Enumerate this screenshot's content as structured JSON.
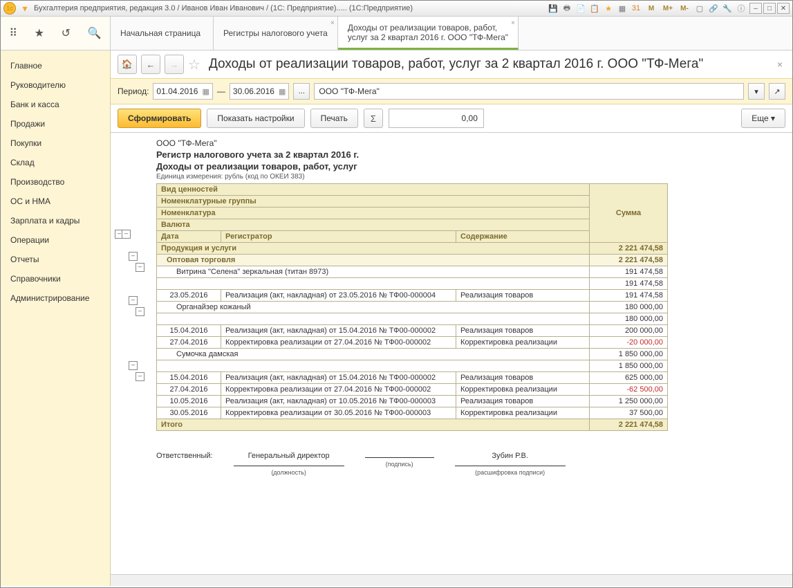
{
  "window_title": "Бухгалтерия предприятия, редакция 3.0 / Иванов Иван Иванович / (1С: Предприятие)..... (1С:Предприятие)",
  "tabs": [
    {
      "label": "Начальная страница"
    },
    {
      "label": "Регистры налогового учета"
    },
    {
      "label": "Доходы от реализации товаров, работ,",
      "label2": "услуг за 2 квартал 2016 г. ООО \"ТФ-Мега\""
    }
  ],
  "sidebar": [
    "Главное",
    "Руководителю",
    "Банк и касса",
    "Продажи",
    "Покупки",
    "Склад",
    "Производство",
    "ОС и НМА",
    "Зарплата и кадры",
    "Операции",
    "Отчеты",
    "Справочники",
    "Администрирование"
  ],
  "page_title": "Доходы от реализации товаров, работ, услуг за 2 квартал 2016 г. ООО \"ТФ-Мега\"",
  "period": {
    "label": "Период:",
    "from": "01.04.2016",
    "to": "30.06.2016",
    "dash": "—"
  },
  "org": "ООО \"ТФ-Мега\"",
  "buttons": {
    "run": "Сформировать",
    "settings": "Показать настройки",
    "print": "Печать",
    "more": "Еще"
  },
  "sumbox": "0,00",
  "report": {
    "org": "ООО \"ТФ-Мега\"",
    "title1": "Регистр налогового учета за 2 квартал 2016 г.",
    "title2": "Доходы от реализации товаров, работ, услуг",
    "unit": "Единица измерения:  рубль (код по ОКЕИ 383)",
    "headers": {
      "h1": "Вид ценностей",
      "h2": "Номенклатурные группы",
      "h3": "Номенклатура",
      "h4": "Валюта",
      "h5": "Дата",
      "h6": "Регистратор",
      "h7": "Содержание",
      "hsum": "Сумма"
    },
    "total_label": "Итого",
    "total": "2 221 474,58",
    "sign": {
      "resp": "Ответственный:",
      "post": "Генеральный директор",
      "post_cap": "(должность)",
      "sign_cap": "(подпись)",
      "name": "Зубин Р.В.",
      "name_cap": "(расшифровка подписи)"
    },
    "rows": [
      {
        "type": "grp",
        "c1": "Продукция и услуги",
        "sum": "2 221 474,58"
      },
      {
        "type": "sub",
        "c1": "Оптовая торговля",
        "sum": "2 221 474,58"
      },
      {
        "type": "nomh",
        "c1": "Витрина \"Селена\" зеркальная (титан 8973)",
        "sum": "191 474,58"
      },
      {
        "type": "cur",
        "c1": "",
        "sum": "191 474,58"
      },
      {
        "type": "row",
        "date": "23.05.2016",
        "reg": "Реализация (акт, накладная) от 23.05.2016 № ТФ00-000004",
        "cont": "Реализация товаров",
        "sum": "191 474,58"
      },
      {
        "type": "nomh",
        "c1": "Органайзер кожаный",
        "sum": "180 000,00"
      },
      {
        "type": "cur",
        "c1": "",
        "sum": "180 000,00"
      },
      {
        "type": "row",
        "date": "15.04.2016",
        "reg": "Реализация (акт, накладная) от 15.04.2016 № ТФ00-000002",
        "cont": "Реализация товаров",
        "sum": "200 000,00"
      },
      {
        "type": "row",
        "date": "27.04.2016",
        "reg": "Корректировка реализации от 27.04.2016 № ТФ00-000002",
        "cont": "Корректировка реализации",
        "sum": "-20 000,00",
        "neg": true
      },
      {
        "type": "nomh",
        "c1": "Сумочка дамская",
        "sum": "1 850 000,00"
      },
      {
        "type": "cur",
        "c1": "",
        "sum": "1 850 000,00"
      },
      {
        "type": "row",
        "date": "15.04.2016",
        "reg": "Реализация (акт, накладная) от 15.04.2016 № ТФ00-000002",
        "cont": "Реализация товаров",
        "sum": "625 000,00"
      },
      {
        "type": "row",
        "date": "27.04.2016",
        "reg": "Корректировка реализации от 27.04.2016 № ТФ00-000002",
        "cont": "Корректировка реализации",
        "sum": "-62 500,00",
        "neg": true
      },
      {
        "type": "row",
        "date": "10.05.2016",
        "reg": "Реализация (акт, накладная) от 10.05.2016 № ТФ00-000003",
        "cont": "Реализация товаров",
        "sum": "1 250 000,00"
      },
      {
        "type": "row",
        "date": "30.05.2016",
        "reg": "Корректировка реализации от 30.05.2016 № ТФ00-000003",
        "cont": "Корректировка реализации",
        "sum": "37 500,00"
      }
    ]
  }
}
